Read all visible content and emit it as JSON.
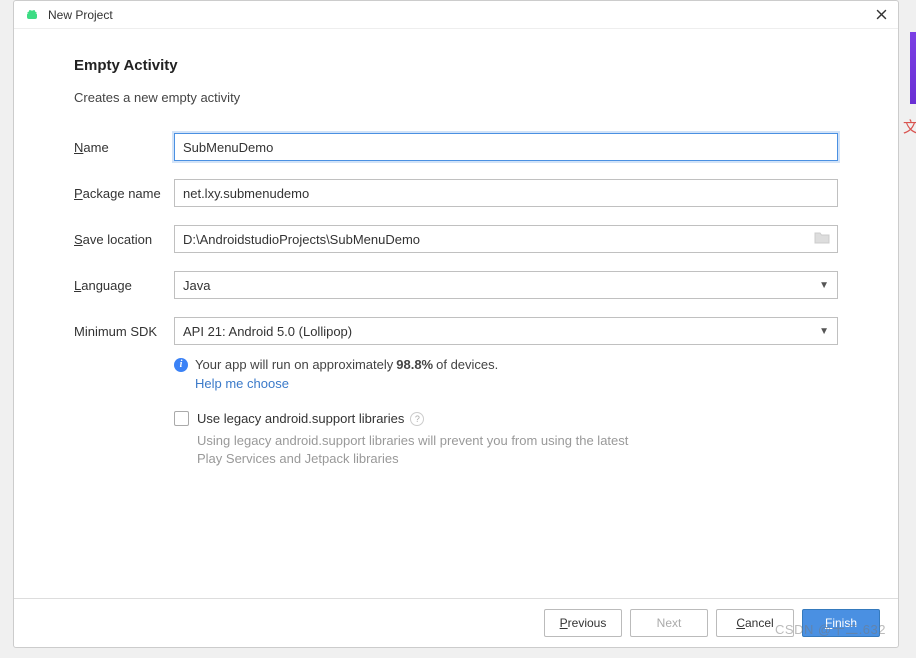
{
  "titlebar": {
    "title": "New Project"
  },
  "header": {
    "heading": "Empty Activity",
    "subtext": "Creates a new empty activity"
  },
  "form": {
    "name_label_prefix": "N",
    "name_label_rest": "ame",
    "name_value": "SubMenuDemo",
    "package_label_prefix": "P",
    "package_label_rest": "ackage name",
    "package_value": "net.lxy.submenudemo",
    "save_label_prefix": "S",
    "save_label_rest": "ave location",
    "save_value": "D:\\AndroidstudioProjects\\SubMenuDemo",
    "language_label_prefix": "L",
    "language_label_rest": "anguage",
    "language_value": "Java",
    "minsdk_label": "Minimum SDK",
    "minsdk_value": "API 21: Android 5.0 (Lollipop)"
  },
  "info": {
    "prefix": "Your app will run on approximately",
    "percent": "98.8%",
    "suffix": "of devices.",
    "help_link": "Help me choose"
  },
  "legacy": {
    "checkbox_label": "Use legacy android.support libraries",
    "description": "Using legacy android.support libraries will prevent you from using the latest Play Services and Jetpack libraries"
  },
  "buttons": {
    "previous_prefix": "P",
    "previous_rest": "revious",
    "next": "Next",
    "cancel_prefix": "C",
    "cancel_rest": "ancel",
    "finish_prefix": "F",
    "finish_rest": "inish"
  },
  "watermark": "CSDN @十二.632",
  "side_text": "文"
}
